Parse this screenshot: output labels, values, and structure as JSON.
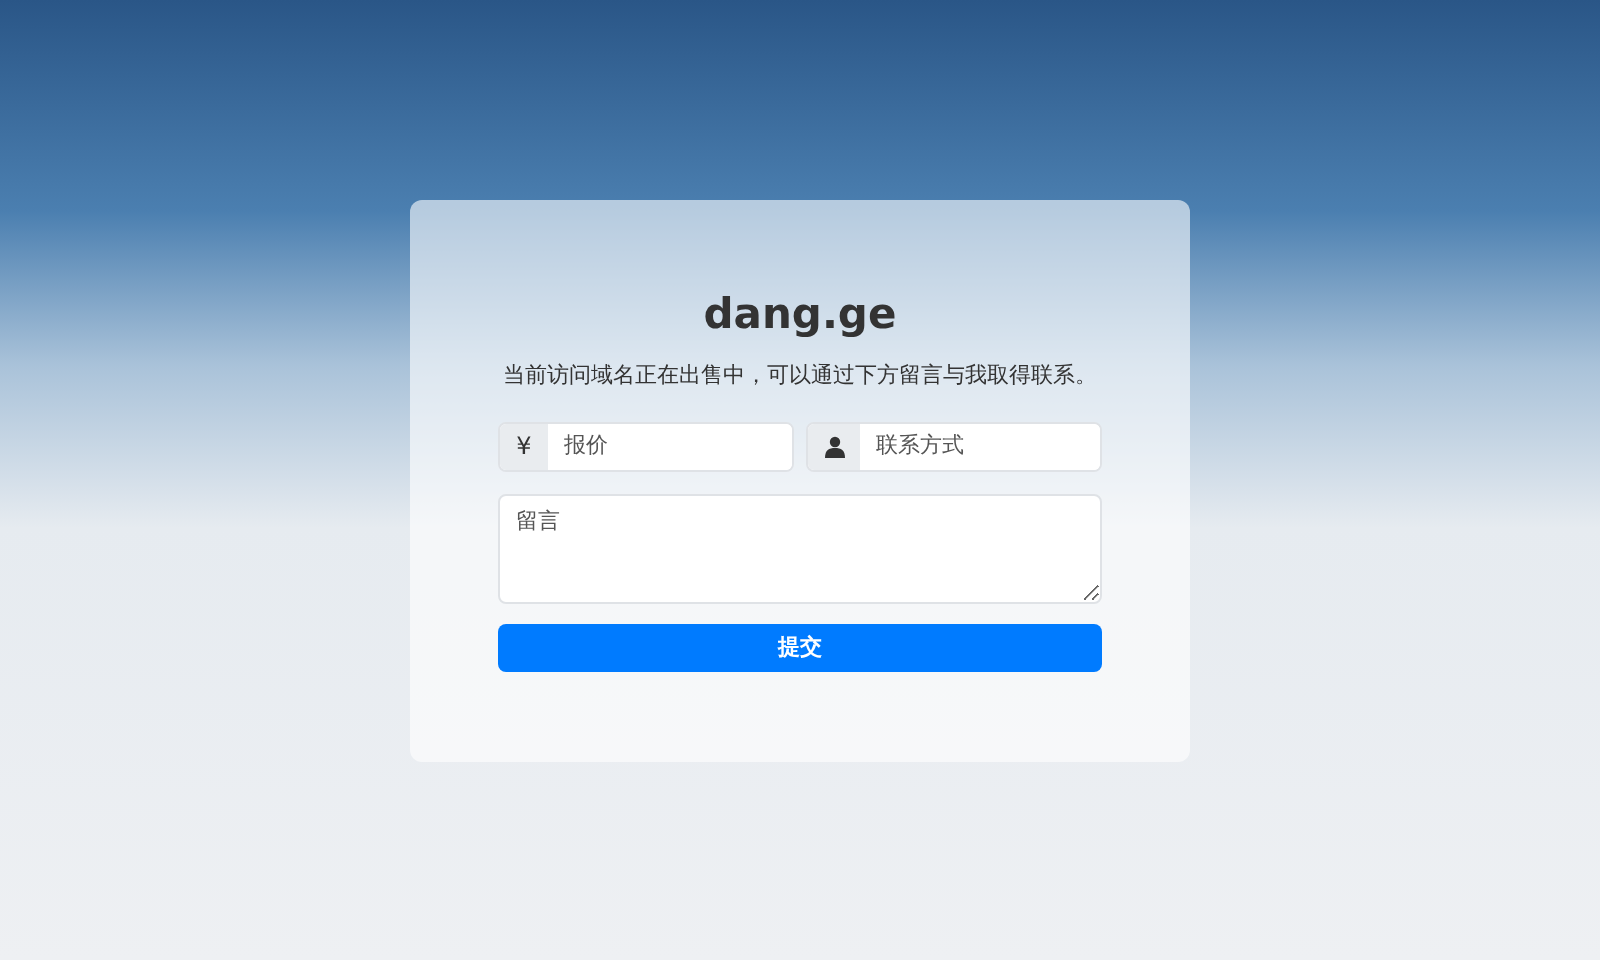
{
  "title": "dang.ge",
  "message": "当前访问域名正在出售中，可以通过下方留言与我取得联系。",
  "price_field": {
    "prefix": "¥",
    "placeholder": "报价"
  },
  "contact_field": {
    "placeholder": "联系方式"
  },
  "message_field": {
    "placeholder": "留言"
  },
  "submit_button": {
    "label": "提交"
  }
}
